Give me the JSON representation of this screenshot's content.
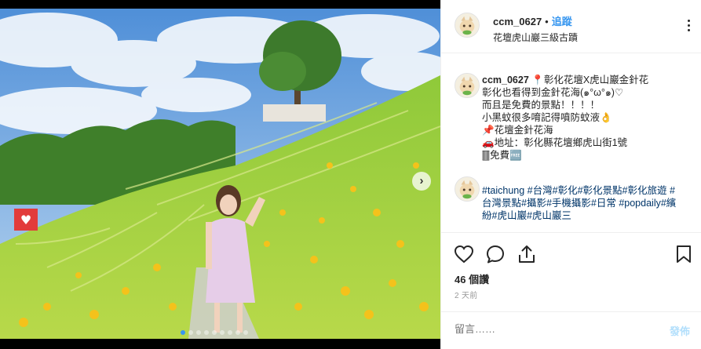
{
  "post": {
    "username": "ccm_0627",
    "separator": "•",
    "follow_label": "追蹤",
    "location": "花壇虎山巖三級古蹟"
  },
  "caption": {
    "username": "ccm_0627",
    "text": "📍彰化花壇X虎山巖金針花\n彰化也看得到金針花海(๑°ω°๑)♡\n而且是免費的景點！！！！\n小黑蚊很多唷記得噴防蚊液👌\n📌花壇金針花海\n🚗地址：彰化縣花壇鄉虎山街1號\n🀫免費🆓"
  },
  "comment": {
    "hashtags": "#taichung #台灣#彰化#彰化景點#彰化旅遊 #台灣景點#攝影#手機攝影#日常 #popdaily#繽紛#虎山巖#虎山巖三"
  },
  "actions": {
    "like_icon": "heart-icon",
    "comment_icon": "comment-bubble-icon",
    "share_icon": "share-icon",
    "save_icon": "bookmark-icon"
  },
  "stats": {
    "views": "46 個讚",
    "time": "2 天前"
  },
  "comment_box": {
    "placeholder": "留言……",
    "post_label": "發佈"
  },
  "carousel": {
    "next_icon": "chevron-right-icon",
    "slides": 9,
    "active_slide": 1
  },
  "colors": {
    "accent": "#3897f0",
    "hashtag": "#003569",
    "post_disabled": "#b2dffc"
  }
}
